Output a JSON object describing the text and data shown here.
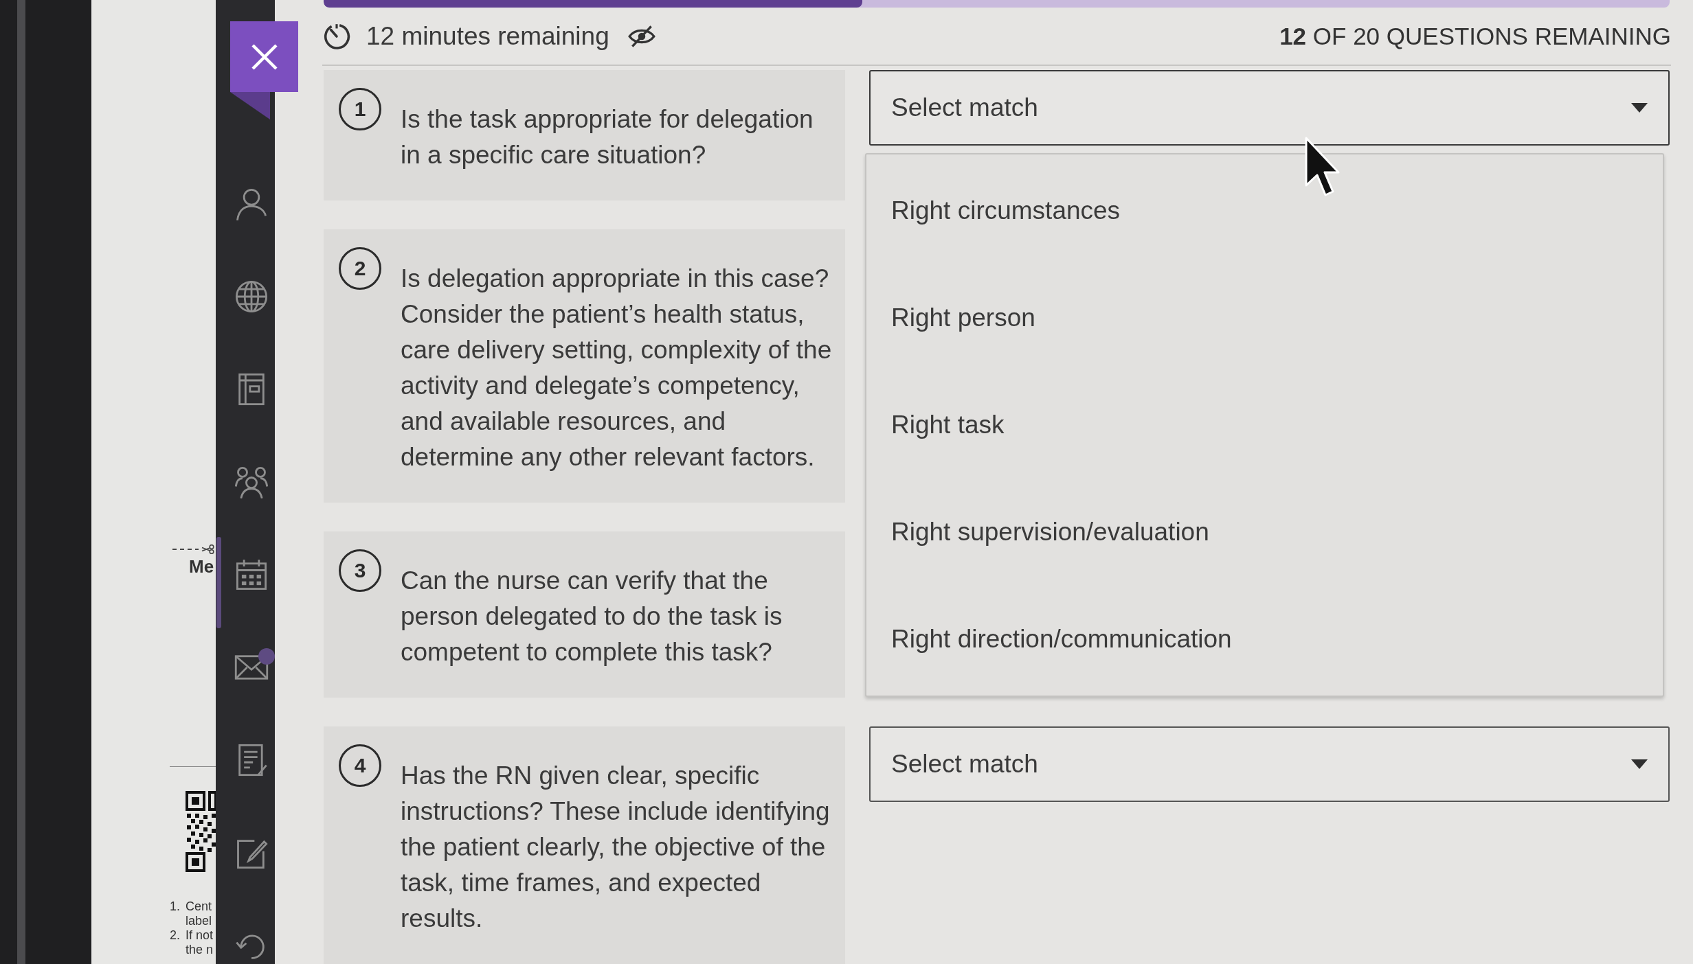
{
  "progress": {
    "level": 0.4
  },
  "timer": {
    "text": "12 minutes remaining"
  },
  "questions_remaining": "**12** OF 20 QUESTIONS REMAINING",
  "questions": [
    {
      "number": "1",
      "text": "Is the task appropriate for delegation in a specific care situation?",
      "select": {
        "placeholder": "Select match",
        "expanded": true,
        "options": [
          {
            "label": "Right circumstances",
            "selected": false
          },
          {
            "label": "Right person",
            "selected": false
          },
          {
            "label": "Right task",
            "selected": false
          },
          {
            "label": "Right supervision/evaluation",
            "selected": false
          },
          {
            "label": "Right direction/communication",
            "selected": false
          }
        ]
      }
    },
    {
      "number": "2",
      "text": "Is delegation appropriate in this case? Consider the patient’s health status, care delivery setting, complexity of the activity and delegate’s competency, and available resources, and determine any other relevant factors."
    },
    {
      "number": "3",
      "text": "Can the nurse can verify that the person delegated to do the task is competent to complete this task?"
    },
    {
      "number": "4",
      "text": "Has the RN given clear, specific instructions? These include identifying the patient clearly, the objective of the task, time frames, and expected results.",
      "select": {
        "placeholder": "Select match",
        "expanded": false
      }
    }
  ],
  "paper_note": {
    "heading": "Me",
    "items": [
      {
        "marker": "1.",
        "lines": [
          "Cent",
          "label"
        ]
      },
      {
        "marker": "2.",
        "lines": [
          "If not",
          "the n"
        ]
      }
    ]
  }
}
